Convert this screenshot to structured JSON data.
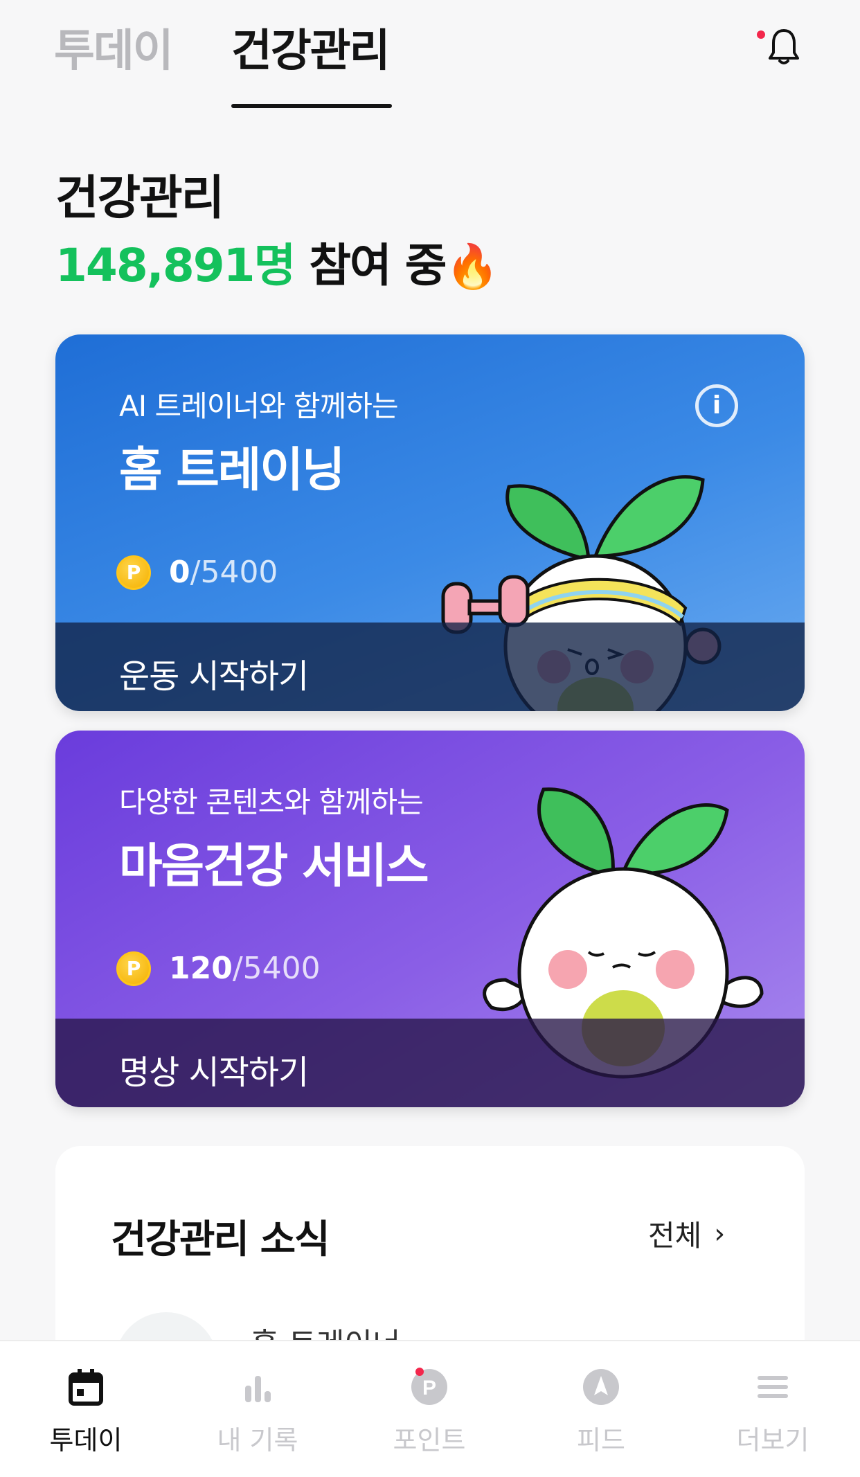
{
  "top_tabs": {
    "today": "투데이",
    "health": "건강관리"
  },
  "heading": {
    "title": "건강관리",
    "participants_count": "148,891명",
    "participants_suffix": " 참여 중",
    "emoji": "🔥"
  },
  "cards": [
    {
      "subtitle": "AI 트레이너와 함께하는",
      "title": "홈 트레이닝",
      "points_current": "0",
      "points_max": "/5400",
      "coin_label": "P",
      "action": "운동 시작하기",
      "info_icon": "info-icon"
    },
    {
      "subtitle": "다양한 콘텐츠와 함께하는",
      "title": "마음건강 서비스",
      "points_current": "120",
      "points_max": "/5400",
      "coin_label": "P",
      "action": "명상 시작하기"
    }
  ],
  "news": {
    "title": "건강관리 소식",
    "view_all": "전체",
    "first_item": "홈 트레이너"
  },
  "bottom_nav": {
    "items": [
      {
        "label": "투데이",
        "icon": "calendar-icon",
        "active": true
      },
      {
        "label": "내 기록",
        "icon": "bar-chart-icon",
        "active": false
      },
      {
        "label": "포인트",
        "icon": "points-icon",
        "active": false,
        "badge": true
      },
      {
        "label": "피드",
        "icon": "compass-icon",
        "active": false
      },
      {
        "label": "더보기",
        "icon": "menu-icon",
        "active": false
      }
    ]
  },
  "colors": {
    "accent_green": "#14c15c",
    "notification_red": "#f3274c",
    "card_blue": "#1f6ed6",
    "card_purple": "#6a3cdc"
  }
}
